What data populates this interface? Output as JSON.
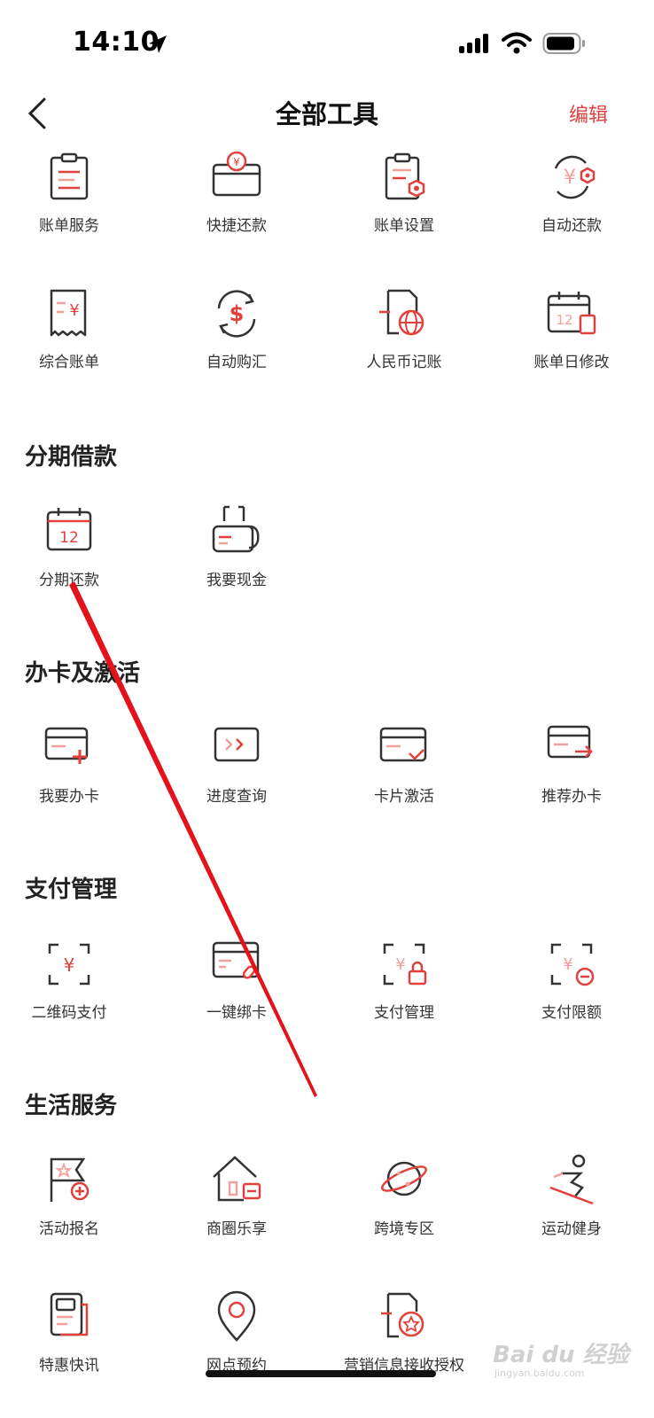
{
  "status": {
    "time": "14:10"
  },
  "nav": {
    "title": "全部工具",
    "edit": "编辑"
  },
  "top_tools": [
    {
      "label": "账单服务",
      "icon": "bill-clipboard-icon"
    },
    {
      "label": "快捷还款",
      "icon": "quick-repay-icon"
    },
    {
      "label": "账单设置",
      "icon": "bill-settings-icon"
    },
    {
      "label": "自动还款",
      "icon": "auto-repay-icon"
    },
    {
      "label": "综合账单",
      "icon": "receipt-icon"
    },
    {
      "label": "自动购汇",
      "icon": "dollar-exchange-icon"
    },
    {
      "label": "人民币记账",
      "icon": "rmb-globe-icon"
    },
    {
      "label": "账单日修改",
      "icon": "calendar-edit-icon"
    }
  ],
  "sections": [
    {
      "title": "分期借款",
      "items": [
        {
          "label": "分期还款",
          "icon": "calendar-12-icon"
        },
        {
          "label": "我要现金",
          "icon": "cash-hand-icon"
        }
      ]
    },
    {
      "title": "办卡及激活",
      "items": [
        {
          "label": "我要办卡",
          "icon": "card-add-icon"
        },
        {
          "label": "进度查询",
          "icon": "progress-icon"
        },
        {
          "label": "卡片激活",
          "icon": "card-check-icon"
        },
        {
          "label": "推荐办卡",
          "icon": "card-share-icon"
        }
      ]
    },
    {
      "title": "支付管理",
      "items": [
        {
          "label": "二维码支付",
          "icon": "qr-pay-icon"
        },
        {
          "label": "一键绑卡",
          "icon": "card-link-icon"
        },
        {
          "label": "支付管理",
          "icon": "pay-lock-icon"
        },
        {
          "label": "支付限额",
          "icon": "pay-limit-icon"
        }
      ]
    },
    {
      "title": "生活服务",
      "items": [
        {
          "label": "活动报名",
          "icon": "flag-signup-icon"
        },
        {
          "label": "商圈乐享",
          "icon": "shop-house-icon"
        },
        {
          "label": "跨境专区",
          "icon": "planet-icon"
        },
        {
          "label": "运动健身",
          "icon": "ski-icon"
        },
        {
          "label": "特惠快讯",
          "icon": "news-icon"
        },
        {
          "label": "网点预约",
          "icon": "location-pin-icon"
        },
        {
          "label": "营销信息接收授权",
          "icon": "doc-star-icon"
        }
      ]
    }
  ],
  "watermark": {
    "main": "Bai du 经验",
    "sub": "jingyan.baidu.com"
  },
  "colors": {
    "accent": "#e0413c",
    "icon_dark": "#333333",
    "icon_light": "#f2a09c"
  }
}
